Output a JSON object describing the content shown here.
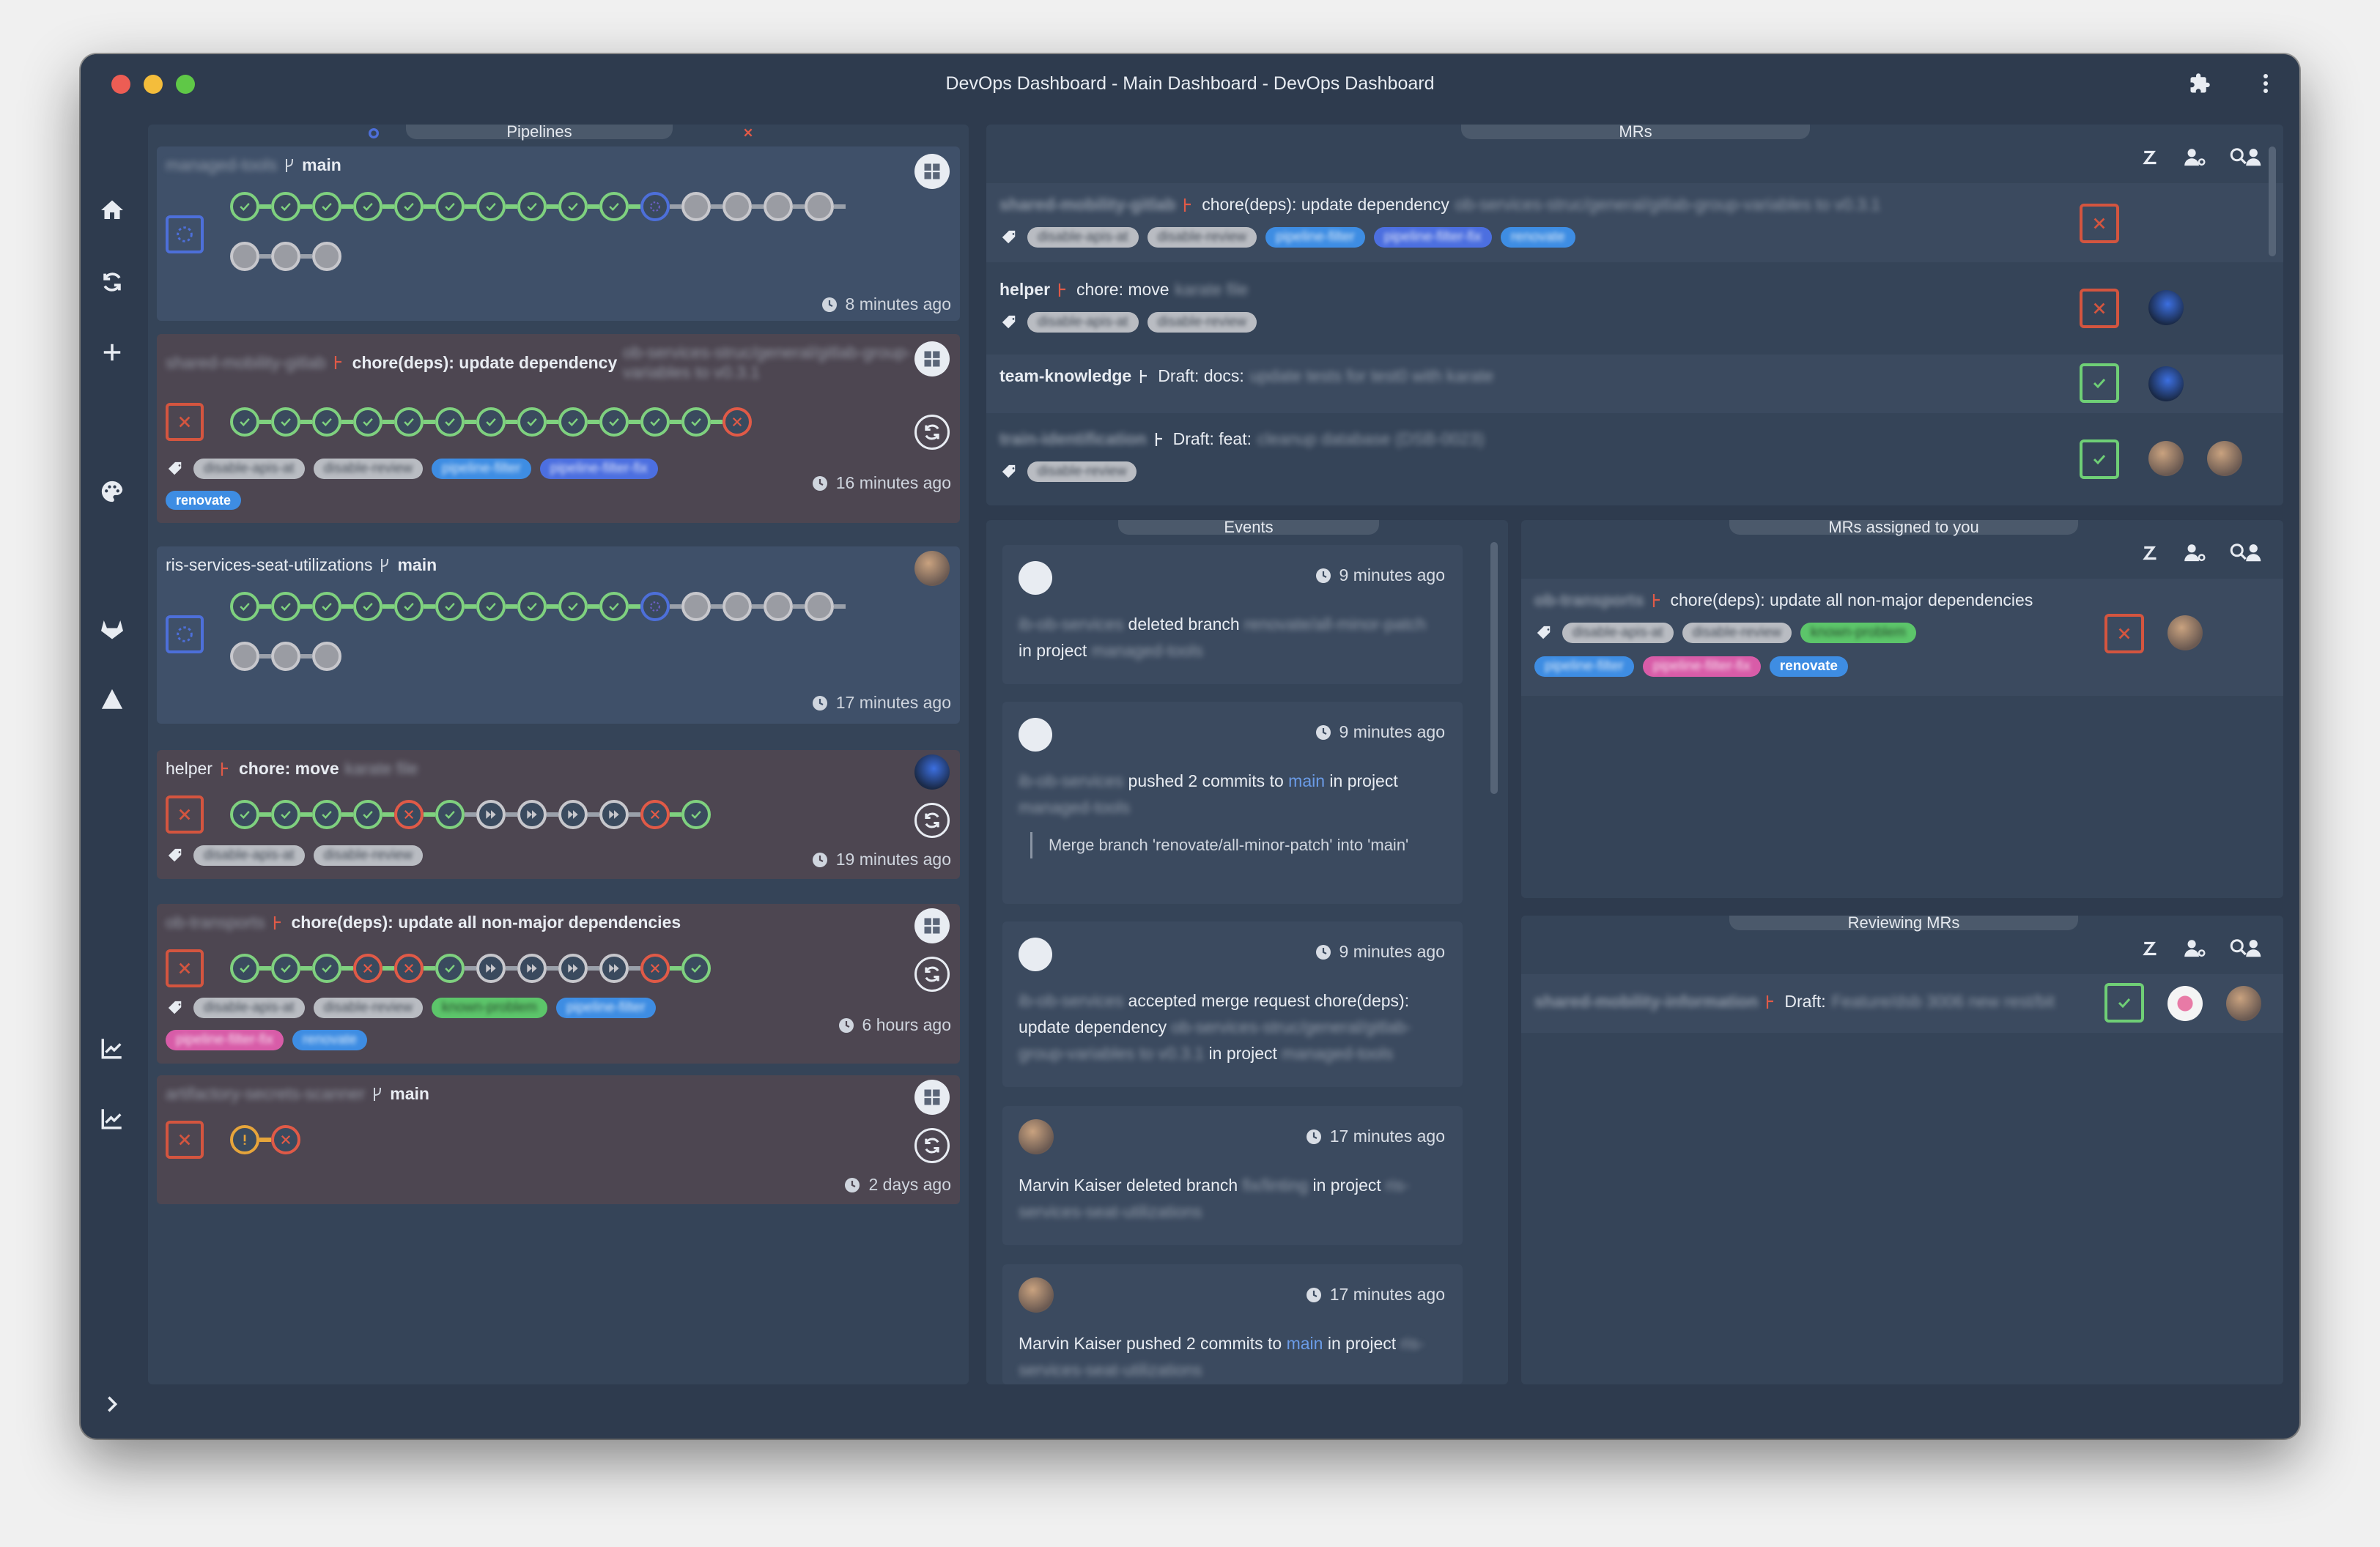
{
  "window": {
    "title": "DevOps Dashboard - Main Dashboard - DevOps Dashboard",
    "traffic_colors": [
      "#ed5d54",
      "#f4bd3b",
      "#5fc847"
    ]
  },
  "titlebar_icons": [
    "puzzle-icon",
    "more-vertical-icon"
  ],
  "sidebar": {
    "icons": [
      "home-icon",
      "sync-icon",
      "plus-icon",
      "palette-icon",
      "gitlab-icon",
      "triangle-icon",
      "chart-icon",
      "chart-icon",
      "chevron-right-icon"
    ]
  },
  "pipelines": {
    "tab": "Pipelines",
    "cards": [
      {
        "project": "managed-tools",
        "branch": "main",
        "time": "8 minutes ago",
        "status": "running"
      },
      {
        "project": "shared-mobility-gitlab",
        "title": "chore(deps): update dependency",
        "title_suffix": "ob-services-struc/general/gitlab-group-variables to v0.3.1",
        "time": "16 minutes ago",
        "status": "failed",
        "tags": [
          "disable-apis-at",
          "disable-review",
          "pipeline-filter",
          "pipeline-filter-fix"
        ],
        "extra_tag": "renovate"
      },
      {
        "project": "ris-services-seat-utilizations",
        "branch": "main",
        "time": "17 minutes ago",
        "status": "running"
      },
      {
        "project": "helper",
        "title": "chore: move",
        "title_suffix": "karate file",
        "time": "19 minutes ago",
        "status": "failed",
        "tags": [
          "disable-apis-at",
          "disable-review"
        ]
      },
      {
        "project": "ob-transports",
        "title": "chore(deps): update all non-major dependencies",
        "time": "6 hours ago",
        "status": "failed",
        "tags": [
          "disable-apis-at",
          "disable-review",
          "known-problem",
          "pipeline-filter",
          "pipeline-filter-fix",
          "renovate"
        ]
      },
      {
        "project": "artifactory-secrets-scanner",
        "branch": "main",
        "time": "2 days ago",
        "status": "failed"
      }
    ]
  },
  "mrs": {
    "tab": "MRs",
    "items": [
      {
        "project": "shared-mobility-gitlab",
        "title": "chore(deps): update dependency",
        "suffix": "ob-services-struc/general/gitlab-group-variables to v0.3.1",
        "tags": [
          "disable-apis-at",
          "disable-review",
          "pipeline-filter",
          "pipeline-filter-fix",
          "renovate"
        ],
        "status": "failed"
      },
      {
        "project": "helper",
        "title": "chore: move",
        "suffix": "karate file",
        "tags": [
          "disable-apis-at",
          "disable-review"
        ],
        "status": "failed"
      },
      {
        "project": "team-knowledge",
        "title": "Draft: docs:",
        "suffix": "update tests for test0 with karate",
        "status": "success"
      },
      {
        "project": "train-identification",
        "title": "Draft: feat:",
        "suffix": "cleanup database (DSB-0023)",
        "tags": [
          "disable-review"
        ],
        "status": "success"
      }
    ]
  },
  "events": {
    "tab": "Events",
    "items": [
      {
        "time": "9 minutes ago",
        "actor": "ib-ob-services",
        "action": "deleted branch",
        "target": "renovate/all-minor-patch",
        "in": "in project",
        "project": "managed-tools"
      },
      {
        "time": "9 minutes ago",
        "actor": "ib-ob-services",
        "action": "pushed 2 commits to",
        "branch": "main",
        "in": "in project",
        "project": "managed-tools",
        "commit": "Merge branch 'renovate/all-minor-patch' into 'main'"
      },
      {
        "time": "9 minutes ago",
        "actor": "ib-ob-services",
        "action": "accepted merge request",
        "mr_title": "chore(deps): update dependency",
        "mr_suffix": "ob-services-struc/general/gitlab-group-variables to v0.3.1",
        "in": "in project",
        "project": "managed-tools"
      },
      {
        "time": "17 minutes ago",
        "actor": "Marvin Kaiser",
        "action": "deleted branch",
        "target": "fix/linting",
        "in": "in project",
        "project": "ris-services-seat-utilizations"
      },
      {
        "time": "17 minutes ago",
        "actor": "Marvin Kaiser",
        "action": "pushed 2 commits to",
        "branch": "main",
        "in": "in project",
        "project": "ris-services-seat-utilizations"
      }
    ]
  },
  "assigned": {
    "tab": "MRs assigned to you",
    "item": {
      "project": "ob-transports",
      "title": "chore(deps): update all non-major dependencies",
      "tags": [
        "disable-apis-at",
        "disable-review",
        "known-problem",
        "pipeline-filter",
        "pipeline-filter-fix"
      ],
      "tag_renovate": "renovate",
      "status": "failed"
    }
  },
  "reviewing": {
    "tab": "Reviewing MRs",
    "item": {
      "project": "shared-mobility-information",
      "title": "Draft:",
      "suffix": "Feature/dsb 3006 new rest/bit",
      "status": "success"
    }
  }
}
